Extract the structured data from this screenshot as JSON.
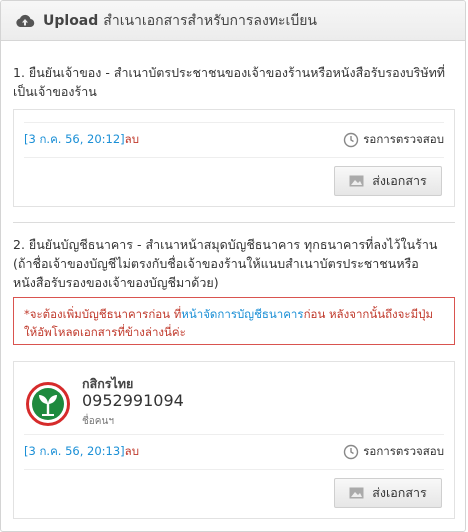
{
  "header": {
    "upload_word": "Upload",
    "title": "สำเนาเอกสารสำหรับการลงทะเบียน",
    "icon": "cloud-upload-icon"
  },
  "section1": {
    "title": "1. ยืนยันเจ้าของ - สำเนาบัตรประชาชนของเจ้าของร้านหรือหนังสือรับรองบริษัทที่เป็นเจ้าของร้าน",
    "file_label": "[3 ก.ค. 56, 20:12]",
    "delete_label": "ลบ",
    "status_text": "รอการตรวจสอบ",
    "send_label": "ส่งเอกสาร"
  },
  "section2": {
    "title": "2. ยืนยันบัญชีธนาคาร - สำเนาหน้าสมุดบัญชีธนาคาร ทุกธนาคารที่ลงไว้ในร้าน (ถ้าชื่อเจ้าของบัญชีไม่ตรงกับชื่อเจ้าของร้านให้แนบสำเนาบัตรประชาชนหรือหนังสือรับรองของเจ้าของบัญชีมาด้วย)",
    "alert_before": "*จะต้องเพิ่มบัญชีธนาคารก่อน ที่",
    "alert_link": "หน้าจัดการบัญชีธนาคาร",
    "alert_after": "ก่อน หลังจากนั้นถึงจะมีปุ่มให้อัพโหลดเอกสารที่ข้างล่างนี่ค่ะ",
    "bank_name": "กสิกรไทย",
    "account_number": "0952991094",
    "account_holder": "ชื่อคนฯ",
    "file_label": "[3 ก.ค. 56, 20:13]",
    "delete_label": "ลบ",
    "status_text": "รอการตรวจสอบ",
    "send_label": "ส่งเอกสาร"
  },
  "colors": {
    "link": "#1a8fd6",
    "danger": "#c0392b",
    "kbank_green": "#1e8a3e",
    "kbank_red": "#d62b2b"
  }
}
